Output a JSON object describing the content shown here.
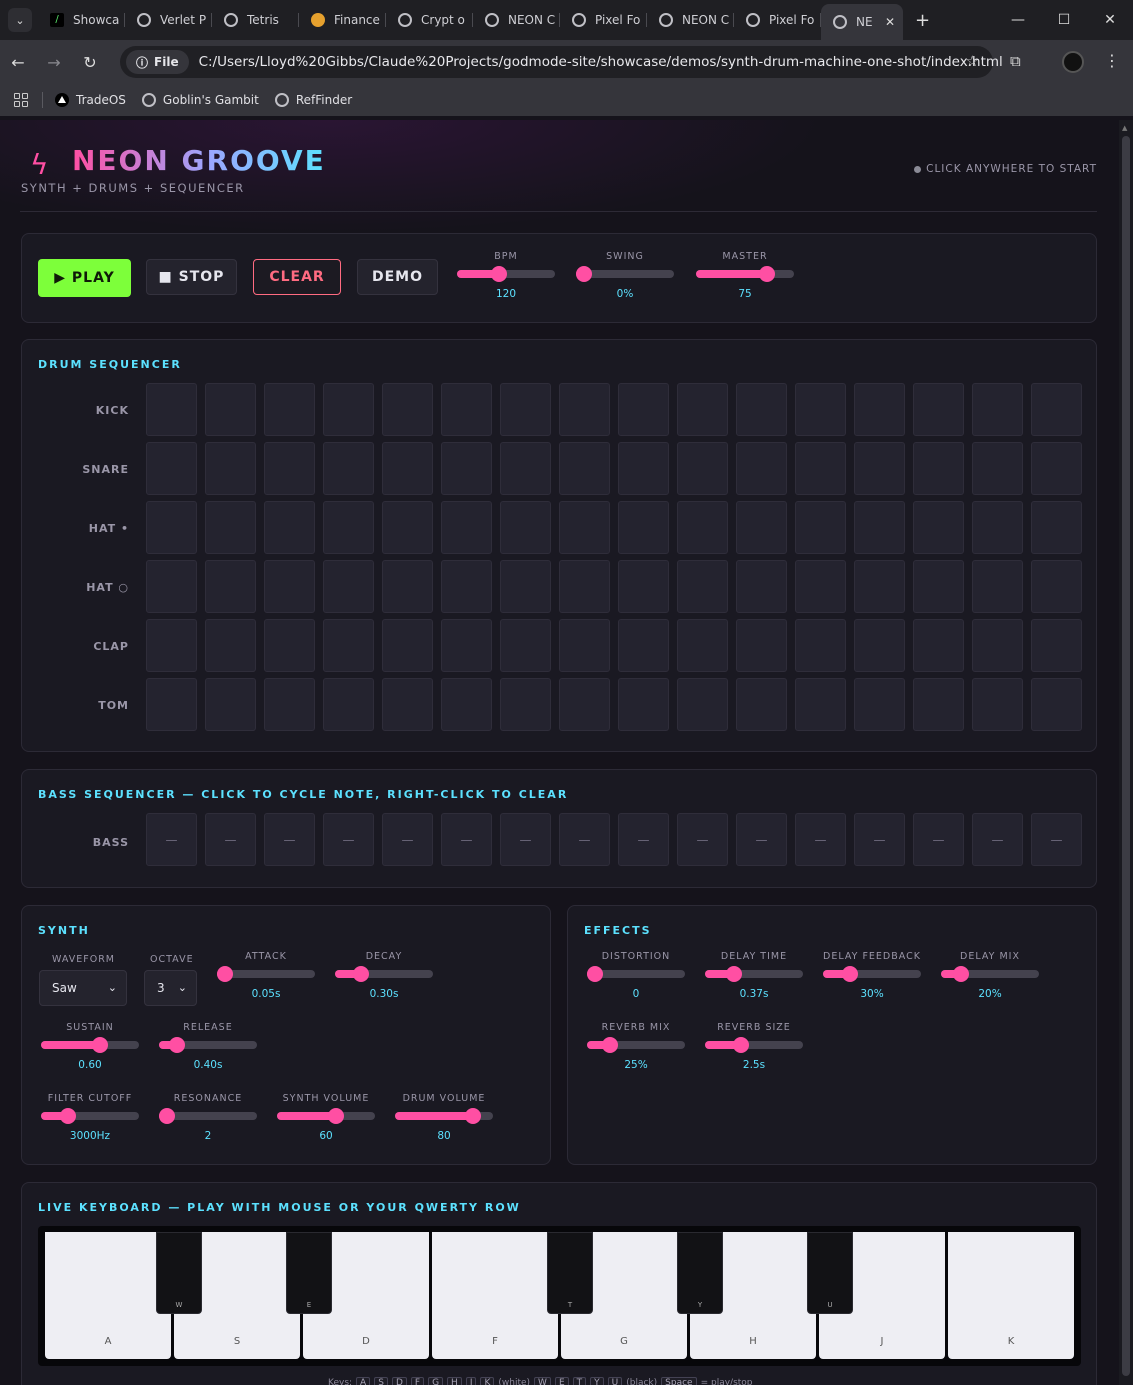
{
  "browser": {
    "tabs": [
      {
        "title": "Showca",
        "icon": "terminal-icon"
      },
      {
        "title": "Verlet P",
        "icon": "globe-icon"
      },
      {
        "title": "Tetris",
        "icon": "globe-icon"
      },
      {
        "title": "Finance",
        "icon": "money-bag-icon"
      },
      {
        "title": "Crypt o",
        "icon": "globe-icon"
      },
      {
        "title": "NEON C",
        "icon": "globe-icon"
      },
      {
        "title": "Pixel Fo",
        "icon": "globe-icon"
      },
      {
        "title": "NEON C",
        "icon": "globe-icon"
      },
      {
        "title": "Pixel Fo",
        "icon": "globe-icon"
      },
      {
        "title": "NE",
        "icon": "globe-icon",
        "active": true
      }
    ],
    "file_label": "File",
    "url": "C:/Users/Lloyd%20Gibbs/Claude%20Projects/godmode-site/showcase/demos/synth-drum-machine-one-shot/index.html",
    "bookmarks": [
      "TradeOS",
      "Goblin's Gambit",
      "RefFinder"
    ]
  },
  "header": {
    "title": "NEON GROOVE",
    "subtitle": "SYNTH + DRUMS + SEQUENCER",
    "start_hint": "CLICK ANYWHERE TO START",
    "accent": "#ff4fa3"
  },
  "transport": {
    "play": "▶ PLAY",
    "stop": "■ STOP",
    "clear": "CLEAR",
    "demo": "DEMO",
    "controls": [
      {
        "label": "BPM",
        "value": "120",
        "level": 0.43
      },
      {
        "label": "SWING",
        "value": "0%",
        "level": 0.0
      },
      {
        "label": "MASTER",
        "value": "75",
        "level": 0.72
      }
    ]
  },
  "drum": {
    "title": "DRUM SEQUENCER",
    "rows": [
      "KICK",
      "SNARE",
      "HAT •",
      "HAT ○",
      "CLAP",
      "TOM"
    ],
    "steps": 16
  },
  "bass": {
    "title": "BASS SEQUENCER — CLICK TO CYCLE NOTE, RIGHT-CLICK TO CLEAR",
    "row_label": "BASS",
    "cells": [
      "—",
      "—",
      "—",
      "—",
      "—",
      "—",
      "—",
      "—",
      "—",
      "—",
      "—",
      "—",
      "—",
      "—",
      "—",
      "—"
    ]
  },
  "synth": {
    "title": "SYNTH",
    "waveform_label": "WAVEFORM",
    "waveform_value": "Saw",
    "octave_label": "OCTAVE",
    "octave_value": "3",
    "controls": [
      {
        "label": "ATTACK",
        "value": "0.05s",
        "level": 0.02
      },
      {
        "label": "DECAY",
        "value": "0.30s",
        "level": 0.27
      },
      {
        "label": "SUSTAIN",
        "value": "0.60",
        "level": 0.6
      },
      {
        "label": "RELEASE",
        "value": "0.40s",
        "level": 0.18
      },
      {
        "label": "FILTER CUTOFF",
        "value": "3000Hz",
        "level": 0.28
      },
      {
        "label": "RESONANCE",
        "value": "2",
        "level": 0.06
      },
      {
        "label": "SYNTH VOLUME",
        "value": "60",
        "level": 0.6
      },
      {
        "label": "DRUM VOLUME",
        "value": "80",
        "level": 0.8
      }
    ]
  },
  "effects": {
    "title": "EFFECTS",
    "controls": [
      {
        "label": "DISTORTION",
        "value": "0",
        "level": 0.0
      },
      {
        "label": "DELAY TIME",
        "value": "0.37s",
        "level": 0.3
      },
      {
        "label": "DELAY FEEDBACK",
        "value": "30%",
        "level": 0.28
      },
      {
        "label": "DELAY MIX",
        "value": "20%",
        "level": 0.2
      },
      {
        "label": "REVERB MIX",
        "value": "25%",
        "level": 0.23
      },
      {
        "label": "REVERB SIZE",
        "value": "2.5s",
        "level": 0.37
      }
    ]
  },
  "keyboard": {
    "title": "LIVE KEYBOARD — PLAY WITH MOUSE OR YOUR QWERTY ROW",
    "white_keys": [
      "A",
      "S",
      "D",
      "F",
      "G",
      "H",
      "J",
      "K"
    ],
    "black_keys": [
      "W",
      "E",
      "T",
      "Y",
      "U"
    ],
    "help_prefix": "Keys:",
    "help_white_suffix": "(white)",
    "help_black_suffix": "(black)",
    "help_space": "Space",
    "help_space_suffix": "= play/stop"
  }
}
